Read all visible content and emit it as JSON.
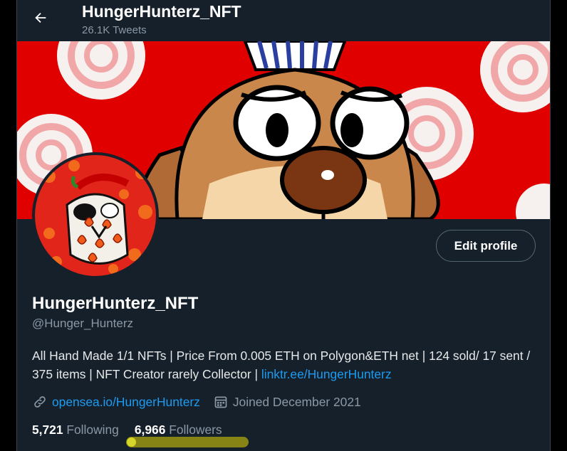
{
  "header": {
    "back_icon": "arrow-left-icon",
    "name": "HungerHunterz_NFT",
    "tweet_count": "26.1K Tweets"
  },
  "banner": {
    "description_icon": "cartoon-character-banner"
  },
  "profile": {
    "edit_button_label": "Edit profile",
    "display_name": "HungerHunterz_NFT",
    "handle": "@Hunger_Hunterz",
    "bio_text": "All Hand Made 1/1 NFTs | Price From 0.005 ETH on Polygon&ETH net | 124 sold/ 17 sent / 375 items | NFT Creator rarely Collector | ",
    "bio_link": "linktr.ee/HungerHunterz",
    "website_icon": "link-icon",
    "website": "opensea.io/HungerHunterz",
    "joined_icon": "calendar-icon",
    "joined": "Joined December 2021"
  },
  "stats": {
    "following_count": "5,721",
    "following_label": "Following",
    "followers_count": "6,966",
    "followers_label": "Followers"
  },
  "colors": {
    "background": "#15202b",
    "accent": "#1d9bf0",
    "secondary_text": "#8b98a5",
    "banner_red": "#e00000",
    "highlight": "#8b8a13"
  }
}
